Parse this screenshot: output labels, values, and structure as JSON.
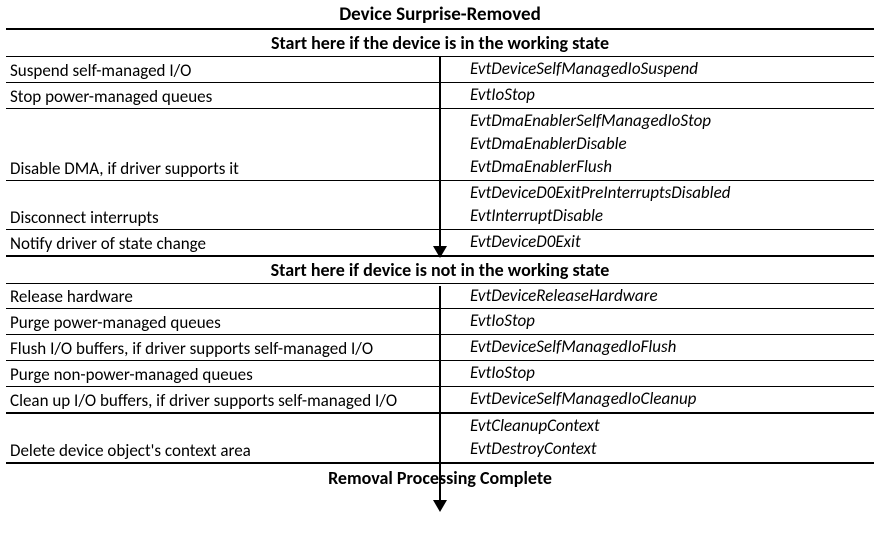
{
  "title": "Device Surprise-Removed",
  "section1_header": "Start here if the device is in the working state",
  "section2_header": "Start here if device is not in the working state",
  "footer": "Removal Processing Complete",
  "s1": {
    "r0": {
      "left": "Suspend self-managed I/O",
      "right0": "EvtDeviceSelfManagedIoSuspend"
    },
    "r1": {
      "left": "Stop power-managed queues",
      "right0": "EvtIoStop"
    },
    "r2": {
      "left": "Disable DMA, if driver supports it",
      "right0": "EvtDmaEnablerSelfManagedIoStop",
      "right1": "EvtDmaEnablerDisable",
      "right2": "EvtDmaEnablerFlush"
    },
    "r3": {
      "left": "Disconnect interrupts",
      "right0": "EvtDeviceD0ExitPreInterruptsDisabled",
      "right1": "EvtInterruptDisable"
    },
    "r4": {
      "left": "Notify driver of state change",
      "right0": "EvtDeviceD0Exit"
    }
  },
  "s2": {
    "r0": {
      "left": "Release hardware",
      "right0": "EvtDeviceReleaseHardware"
    },
    "r1": {
      "left": "Purge power-managed queues",
      "right0": "EvtIoStop"
    },
    "r2": {
      "left": "Flush I/O buffers, if driver supports self-managed I/O",
      "right0": "EvtDeviceSelfManagedIoFlush"
    },
    "r3": {
      "left": "Purge non-power-managed queues",
      "right0": "EvtIoStop"
    },
    "r4": {
      "left": "Clean up I/O buffers, if driver supports self-managed I/O",
      "right0": "EvtDeviceSelfManagedIoCleanup"
    },
    "r5": {
      "left": "Delete device object's context area",
      "right0": "EvtCleanupContext",
      "right1": "EvtDestroyContext"
    }
  },
  "chart_data": {
    "type": "table",
    "title": "Device Surprise-Removed",
    "sections": [
      {
        "header": "Start here if the device is in the working state",
        "rows": [
          {
            "action": "Suspend self-managed I/O",
            "callbacks": [
              "EvtDeviceSelfManagedIoSuspend"
            ]
          },
          {
            "action": "Stop power-managed queues",
            "callbacks": [
              "EvtIoStop"
            ]
          },
          {
            "action": "Disable DMA, if driver supports it",
            "callbacks": [
              "EvtDmaEnablerSelfManagedIoStop",
              "EvtDmaEnablerDisable",
              "EvtDmaEnablerFlush"
            ]
          },
          {
            "action": "Disconnect interrupts",
            "callbacks": [
              "EvtDeviceD0ExitPreInterruptsDisabled",
              "EvtInterruptDisable"
            ]
          },
          {
            "action": "Notify driver of state change",
            "callbacks": [
              "EvtDeviceD0Exit"
            ]
          }
        ]
      },
      {
        "header": "Start here if device is not in the working state",
        "rows": [
          {
            "action": "Release hardware",
            "callbacks": [
              "EvtDeviceReleaseHardware"
            ]
          },
          {
            "action": "Purge power-managed queues",
            "callbacks": [
              "EvtIoStop"
            ]
          },
          {
            "action": "Flush I/O buffers, if driver supports self-managed I/O",
            "callbacks": [
              "EvtDeviceSelfManagedIoFlush"
            ]
          },
          {
            "action": "Purge non-power-managed queues",
            "callbacks": [
              "EvtIoStop"
            ]
          },
          {
            "action": "Clean up I/O buffers, if driver supports self-managed I/O",
            "callbacks": [
              "EvtDeviceSelfManagedIoCleanup"
            ]
          },
          {
            "action": "Delete device object's context area",
            "callbacks": [
              "EvtCleanupContext",
              "EvtDestroyContext"
            ]
          }
        ]
      }
    ],
    "footer": "Removal Processing Complete"
  }
}
